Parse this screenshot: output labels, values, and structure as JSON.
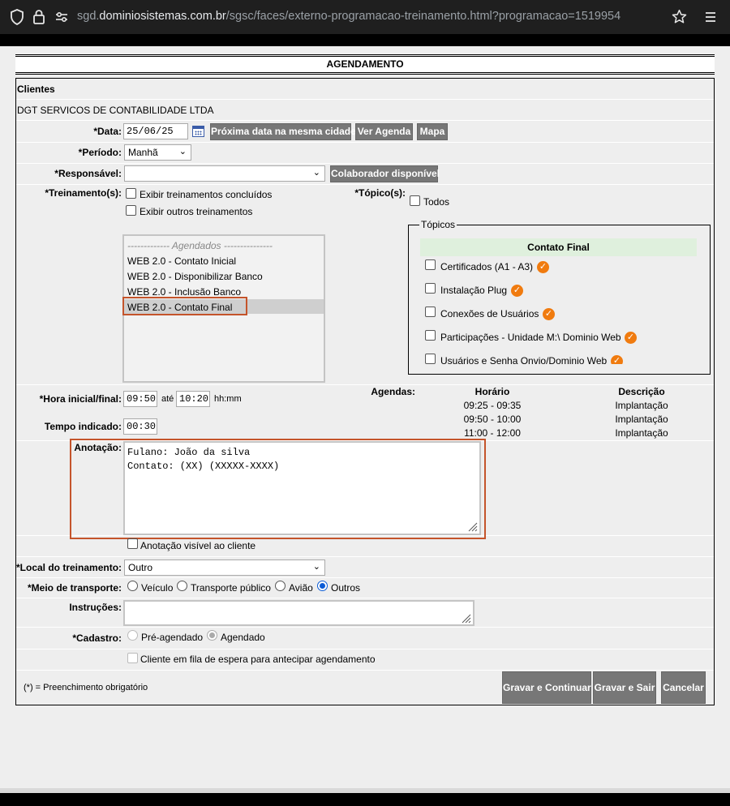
{
  "browser": {
    "url_prefix": "sgd.",
    "url_domain": "dominiosistemas.com.br",
    "url_path": "/sgsc/faces/externo-programacao-treinamento.html?programacao=1519954"
  },
  "page": {
    "title": "AGENDAMENTO"
  },
  "clientes": {
    "label": "Clientes",
    "name": "DGT SERVICOS DE CONTABILIDADE LTDA"
  },
  "data": {
    "label": "*Data:",
    "value": "25/06/25",
    "btn_proxima": "Próxima data na mesma cidade",
    "btn_agenda": "Ver Agenda",
    "btn_mapa": "Mapa"
  },
  "periodo": {
    "label": "*Período:",
    "value": "Manhã"
  },
  "responsavel": {
    "label": "*Responsável:",
    "value": "",
    "btn": "Colaborador disponível"
  },
  "treinamentos": {
    "label": "*Treinamento(s):",
    "chk_concluidos": "Exibir treinamentos concluídos",
    "chk_outros": "Exibir outros treinamentos",
    "group_label": "------------- Agendados ---------------",
    "items": [
      "WEB 2.0 - Contato Inicial",
      "WEB 2.0 - Disponibilizar Banco",
      "WEB 2.0 - Inclusão Banco",
      "WEB 2.0 - Contato Final"
    ]
  },
  "topicos": {
    "label": "*Tópico(s):",
    "todos": "Todos",
    "legend": "Tópicos",
    "header": "Contato Final",
    "items": [
      "Certificados (A1 - A3)",
      "Instalação Plug",
      "Conexões de Usuários",
      "Participações - Unidade M:\\ Dominio Web",
      "Usuários e Senha Onvio/Dominio Web"
    ],
    "tick_color": "#f07b0f"
  },
  "hora": {
    "label": "*Hora inicial/final:",
    "inicio": "09:50",
    "ate": "até",
    "fim": "10:20",
    "unit": "hh:mm"
  },
  "tempo": {
    "label": "Tempo indicado:",
    "value": "00:30"
  },
  "agendas": {
    "label": "Agendas:",
    "col_horario": "Horário",
    "col_descricao": "Descrição",
    "rows": [
      {
        "horario": "09:25 - 09:35",
        "descricao": "Implantação"
      },
      {
        "horario": "09:50 - 10:00",
        "descricao": "Implantação"
      },
      {
        "horario": "11:00 - 12:00",
        "descricao": "Implantação"
      }
    ]
  },
  "anotacao": {
    "label": "Anotação:",
    "line1": "Fulano: João da silva",
    "line2": "Contato: (XX) (XXXXX-XXXX)",
    "chk_visivel": "Anotação visível ao cliente"
  },
  "local": {
    "label": "*Local do treinamento:",
    "value": "Outro"
  },
  "transporte": {
    "label": "*Meio de transporte:",
    "options": [
      "Veículo",
      "Transporte público",
      "Avião",
      "Outros"
    ],
    "selected": "Outros"
  },
  "instrucoes": {
    "label": "Instruções:",
    "value": ""
  },
  "cadastro": {
    "label": "*Cadastro:",
    "options": [
      "Pré-agendado",
      "Agendado"
    ],
    "selected": "Agendado"
  },
  "fila": {
    "label": "Cliente em fila de espera para antecipar agendamento"
  },
  "footer": {
    "note": "(*) = Preenchimento obrigatório",
    "btn_continuar": "Gravar e Continuar",
    "btn_sair": "Gravar e Sair",
    "btn_cancelar": "Cancelar"
  },
  "colors": {
    "button_bg": "#777777",
    "highlight_border": "#c4542b",
    "topic_header_bg": "#dff0dd"
  }
}
